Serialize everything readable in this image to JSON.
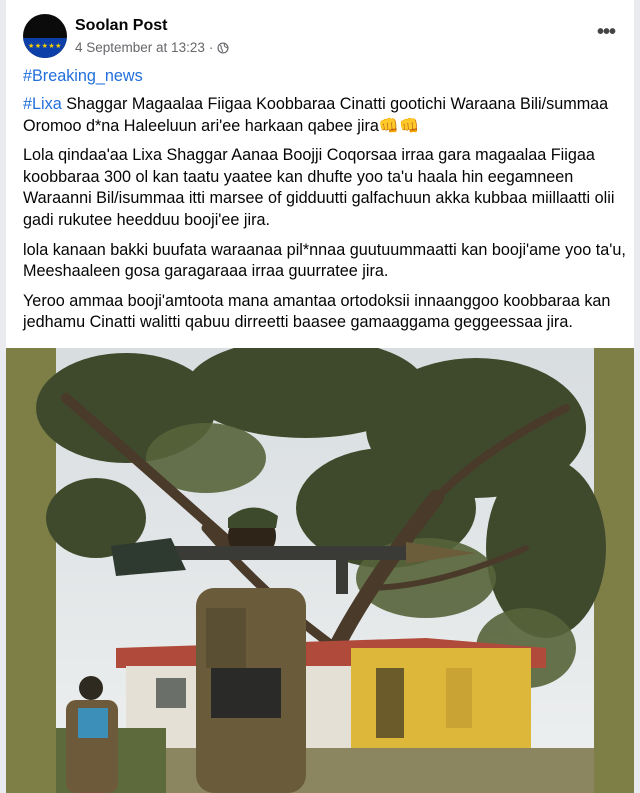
{
  "post": {
    "page_name": "Soolan Post",
    "timestamp": "4 September at 13:23",
    "separator": "·",
    "more_label": "•••",
    "hashtag_line": "#Breaking_news",
    "headline_hashtag": "#Lixa",
    "headline_rest": " Shaggar Magaalaa Fiigaa Koobbaraa Cinatti  gootichi Waraana Bili/summaa Oromoo  d*na Haleeluun ari'ee harkaan qabee jira👊👊",
    "paragraph_1": "Lola qindaa'aa Lixa Shaggar Aanaa Boojji Coqorsaa irraa gara magaalaa Fiigaa koobbaraa 300 ol kan taatu yaatee kan dhufte yoo ta'u haala hin eegamneen Waraanni Bil/isummaa itti marsee of gidduutti galfachuun akka kubbaa miillaatti olii gadi rukutee heedduu booji'ee jira.",
    "paragraph_2": "lola kanaan bakki buufata waraanaa pil*nnaa guutuummaatti kan booji'ame yoo ta'u, Meeshaaleen gosa garagaraaa irraa guurratee  jira.",
    "paragraph_3": "Yeroo ammaa booji'amtoota mana amantaa ortodoksii innaanggoo koobbaraa kan jedhamu Cinatti walitti qabuu  dirreetti baasee gamaaggama geggeessaa jira."
  },
  "avatar": {
    "stars": "★★★★★"
  },
  "colors": {
    "link": "#216fdb",
    "text": "#050505",
    "meta": "#65676b",
    "photo_border": "#7d7f47"
  },
  "icons": [
    "globe-icon",
    "more-options-icon"
  ]
}
